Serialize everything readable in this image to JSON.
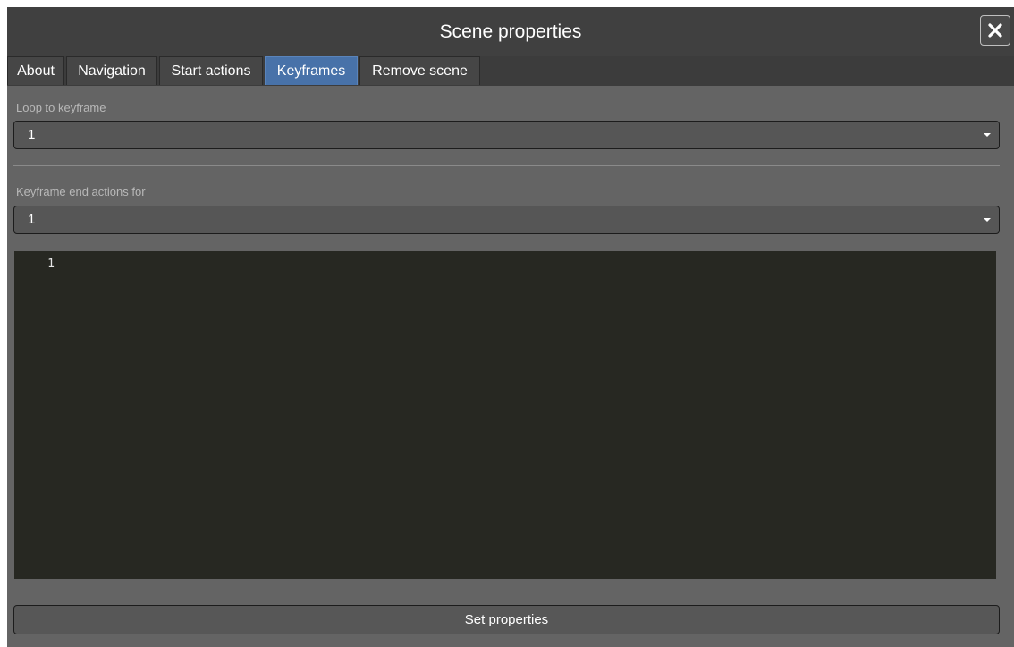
{
  "dialog": {
    "title": "Scene properties",
    "close_icon": "close-icon"
  },
  "tabs": [
    {
      "label": "About",
      "active": false
    },
    {
      "label": "Navigation",
      "active": false
    },
    {
      "label": "Start actions",
      "active": false
    },
    {
      "label": "Keyframes",
      "active": true
    },
    {
      "label": "Remove scene",
      "active": false
    }
  ],
  "loop": {
    "label": "Loop to keyframe",
    "selected": "1"
  },
  "end_actions": {
    "label": "Keyframe end actions for",
    "selected": "1"
  },
  "editor": {
    "line_numbers": [
      "1"
    ],
    "content": ""
  },
  "footer": {
    "submit_label": "Set properties"
  },
  "colors": {
    "active_tab": "#4872a9",
    "editor_bg": "#272822",
    "panel_bg": "#646464"
  }
}
